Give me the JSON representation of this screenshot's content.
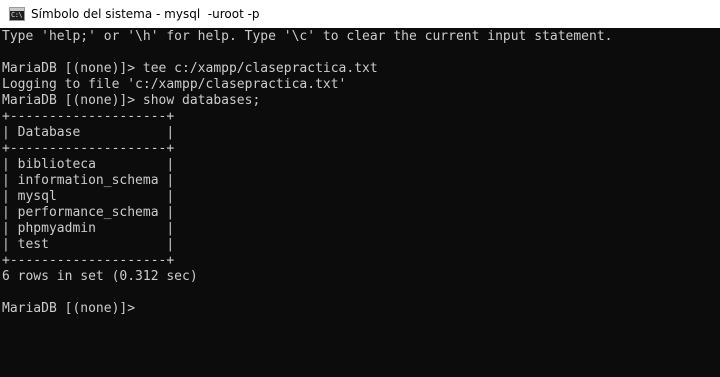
{
  "window": {
    "title": "Símbolo del sistema - mysql  -uroot -p",
    "icon_glyph": "C:\\"
  },
  "console": {
    "lines": [
      "Type 'help;' or '\\h' for help. Type '\\c' to clear the current input statement.",
      "",
      "MariaDB [(none)]> tee c:/xampp/clasepractica.txt",
      "Logging to file 'c:/xampp/clasepractica.txt'",
      "MariaDB [(none)]> show databases;",
      "+--------------------+",
      "| Database           |",
      "+--------------------+",
      "| biblioteca         |",
      "| information_schema |",
      "| mysql              |",
      "| performance_schema |",
      "| phpmyadmin         |",
      "| test               |",
      "+--------------------+",
      "6 rows in set (0.312 sec)",
      "",
      "MariaDB [(none)]>"
    ]
  },
  "colors": {
    "console_bg": "#0c0c0c",
    "console_fg": "#cccccc",
    "titlebar_bg": "#ffffff"
  }
}
